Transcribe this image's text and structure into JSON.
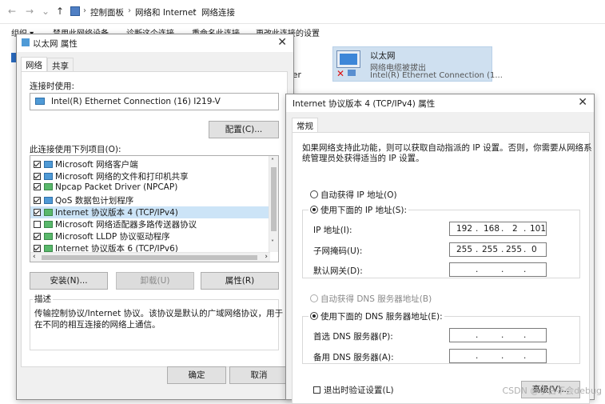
{
  "explorer": {
    "breadcrumb": [
      "控制面板",
      "网络和 Internet",
      "网络连接"
    ],
    "commands": [
      "组织 ▾",
      "禁用此网络设备",
      "诊断这个连接",
      "重命名此连接",
      "更改此连接的设置"
    ],
    "adapter": {
      "name": "以太网",
      "status": "网络电缆被拔出",
      "device": "Intel(R) Ethernet Connection (1..."
    },
    "partial_text": "er"
  },
  "eth_props": {
    "title": "以太网 属性",
    "tabs": [
      "网络",
      "共享"
    ],
    "connect_using_label": "连接时使用:",
    "adapter_name": "Intel(R) Ethernet Connection (16) I219-V",
    "configure_button": "配置(C)...",
    "items_label": "此连接使用下列项目(O):",
    "items": [
      {
        "label": "Microsoft 网络客户端",
        "checked": true
      },
      {
        "label": "Microsoft 网络的文件和打印机共享",
        "checked": true
      },
      {
        "label": "Npcap Packet Driver (NPCAP)",
        "checked": true
      },
      {
        "label": "QoS 数据包计划程序",
        "checked": true
      },
      {
        "label": "Internet 协议版本 4 (TCP/IPv4)",
        "checked": true
      },
      {
        "label": "Microsoft 网络适配器多路传送器协议",
        "checked": false
      },
      {
        "label": "Microsoft LLDP 协议驱动程序",
        "checked": true
      },
      {
        "label": "Internet 协议版本 6 (TCP/IPv6)",
        "checked": true
      }
    ],
    "install_button": "安装(N)...",
    "uninstall_button": "卸载(U)",
    "properties_button": "属性(R)",
    "description_label": "描述",
    "description_line1": "传输控制协议/Internet 协议。该协议是默认的广域网络协议，用于",
    "description_line2": "在不同的相互连接的网络上通信。",
    "ok_button": "确定",
    "cancel_button": "取消"
  },
  "ipv4": {
    "title": "Internet 协议版本 4 (TCP/IPv4) 属性",
    "tab": "常规",
    "intro_line1": "如果网络支持此功能，则可以获取自动指派的 IP 设置。否则，你需要从网络系",
    "intro_line2": "统管理员处获得适当的 IP 设置。",
    "auto_ip": "自动获得 IP 地址(O)",
    "use_ip": "使用下面的 IP 地址(S):",
    "ip_label": "IP 地址(I):",
    "ip_octets": [
      "192",
      "168",
      "2",
      "101"
    ],
    "mask_label": "子网掩码(U):",
    "mask_octets": [
      "255",
      "255",
      "255",
      "0"
    ],
    "gateway_label": "默认网关(D):",
    "auto_dns": "自动获得 DNS 服务器地址(B)",
    "use_dns": "使用下面的 DNS 服务器地址(E):",
    "dns1_label": "首选 DNS 服务器(P):",
    "dns2_label": "备用 DNS 服务器(A):",
    "validate_label": "退出时验证设置(L)",
    "advanced_button": "高级(V)...",
    "dot": "."
  },
  "watermark": "CSDN @小白不会debug"
}
